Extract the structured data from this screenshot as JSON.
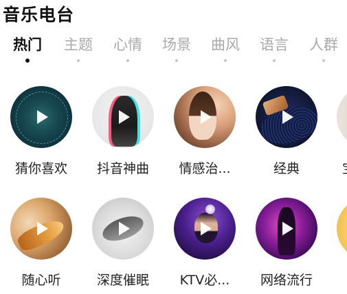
{
  "page": {
    "title": "音乐电台"
  },
  "tabs": [
    {
      "label": "热门",
      "active": true
    },
    {
      "label": "主题",
      "active": false
    },
    {
      "label": "心情",
      "active": false
    },
    {
      "label": "场景",
      "active": false
    },
    {
      "label": "曲风",
      "active": false
    },
    {
      "label": "语言",
      "active": false
    },
    {
      "label": "人群",
      "active": false
    }
  ],
  "rows": [
    {
      "items": [
        {
          "label": "猜你喜欢"
        },
        {
          "label": "抖音神曲"
        },
        {
          "label": "情感治..."
        },
        {
          "label": "经典"
        },
        {
          "label": "宝"
        }
      ]
    },
    {
      "items": [
        {
          "label": "随心听"
        },
        {
          "label": "深度催眠"
        },
        {
          "label": "KTV必..."
        },
        {
          "label": "网络流行"
        },
        {
          "label": ""
        }
      ]
    }
  ],
  "colors": {
    "active_tab": "#111111",
    "inactive_tab": "#a9a9a9",
    "background": "#ffffff"
  }
}
